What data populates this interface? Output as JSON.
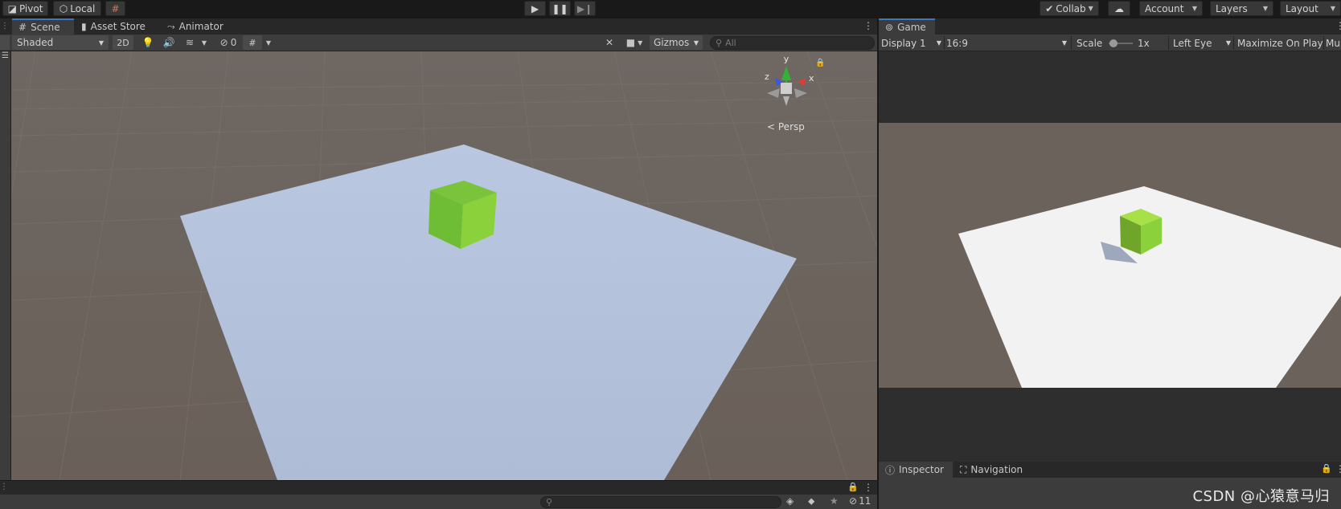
{
  "toolbar": {
    "pivot_label": "Pivot",
    "local_label": "Local",
    "collab_label": "Collab",
    "account_label": "Account",
    "layers_label": "Layers",
    "layout_label": "Layout"
  },
  "scene": {
    "tabs": [
      {
        "label": "Scene",
        "icon": "grid-icon",
        "active": true
      },
      {
        "label": "Asset Store",
        "icon": "bag-icon",
        "active": false
      },
      {
        "label": "Animator",
        "icon": "animator-icon",
        "active": false
      }
    ],
    "shading_mode": "Shaded",
    "two_d_label": "2D",
    "hidden_count": "0",
    "gizmos_label": "Gizmos",
    "search_placeholder": "All",
    "gizmo": {
      "x": "x",
      "y": "y",
      "z": "z"
    },
    "projection_label": "Persp"
  },
  "game": {
    "tab_label": "Game",
    "display": "Display 1",
    "aspect": "16:9",
    "scale_label": "Scale",
    "scale_value": "1x",
    "eye": "Left Eye",
    "maximize_label": "Maximize On Play",
    "mute_label": "Mu"
  },
  "console": {
    "hidden_count": "11"
  },
  "inspector": {
    "tabs": [
      {
        "label": "Inspector",
        "icon": "info-icon"
      },
      {
        "label": "Navigation",
        "icon": "navigation-icon"
      }
    ]
  },
  "watermark": "CSDN @心猿意马归",
  "colors": {
    "accent": "#3a79bb",
    "panel": "#3c3c3c",
    "tabbar": "#282828",
    "cube_green": "#8bd13c",
    "scene_plane": "#b4c3dd",
    "game_plane": "#f2f2f2",
    "ground": "#6b625b"
  }
}
